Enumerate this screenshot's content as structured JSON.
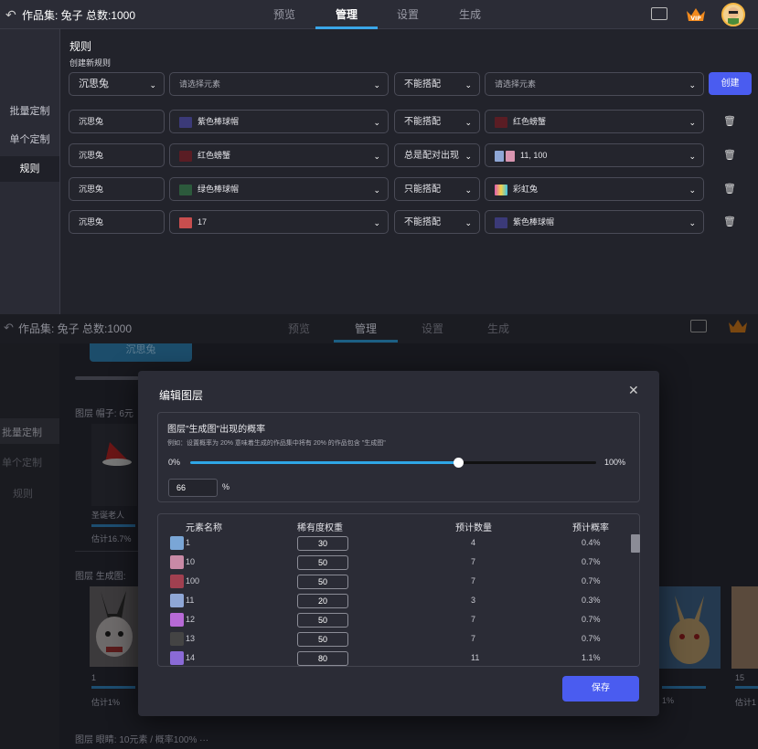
{
  "app": {
    "title": "作品集: 兔子  总数:1000",
    "tabs": [
      "预览",
      "管理",
      "设置",
      "生成"
    ],
    "active_tab": "管理"
  },
  "sidebar": {
    "items": [
      "批量定制",
      "单个定制",
      "规则"
    ],
    "active": "规则"
  },
  "rules": {
    "title": "规则",
    "create_label": "创建新规则",
    "new_rule": {
      "layer": "沉思兔",
      "element": "请选择元素",
      "relation": "不能搭配",
      "target": "请选择元素",
      "create_button": "创建"
    },
    "list": [
      {
        "layer": "沉思兔",
        "element": "紫色棒球帽",
        "relation": "不能搭配",
        "target": "红色螃蟹"
      },
      {
        "layer": "沉思兔",
        "element": "红色螃蟹",
        "relation": "总是配对出现",
        "target": "11, 100"
      },
      {
        "layer": "沉思兔",
        "element": "绿色棒球帽",
        "relation": "只能搭配",
        "target": "彩虹兔"
      },
      {
        "layer": "沉思兔",
        "element": "17",
        "relation": "不能搭配",
        "target": "紫色棒球帽"
      }
    ]
  },
  "background": {
    "title": "作品集: 兔子  总数:1000",
    "tabs": [
      "预览",
      "管理",
      "设置",
      "生成"
    ],
    "sidebar": [
      "批量定制",
      "单个定制",
      "规则"
    ],
    "chip": "沉思兔",
    "layer1": "图层  帽子: 6元",
    "layer1_item": "圣诞老人",
    "layer1_est": "估计16.7%",
    "layer2": "图层  生成图:",
    "card_left_label": "1",
    "card_left_est": "估计1%",
    "card_right_label1": "15",
    "card_right_est1": "估计1",
    "card_right_est2": "1%",
    "layer3": "图层  眼睛: 10元素 / 概率100%  ···"
  },
  "modal": {
    "title": "编辑图层",
    "prob_title": "图层\"生成图\"出现的概率",
    "prob_hint": "例如：设置概率为 20% 意味着生成的作品集中将有 20% 的作品包含 \"生成图\"",
    "min_label": "0%",
    "max_label": "100%",
    "value": "66",
    "value_percent": 66,
    "unit": "%",
    "columns": [
      "元素名称",
      "稀有度权重",
      "预计数量",
      "预计概率"
    ],
    "rows": [
      {
        "name": "1",
        "weight": "30",
        "count": "4",
        "prob": "0.4%"
      },
      {
        "name": "10",
        "weight": "50",
        "count": "7",
        "prob": "0.7%"
      },
      {
        "name": "100",
        "weight": "50",
        "count": "7",
        "prob": "0.7%"
      },
      {
        "name": "11",
        "weight": "20",
        "count": "3",
        "prob": "0.3%"
      },
      {
        "name": "12",
        "weight": "50",
        "count": "7",
        "prob": "0.7%"
      },
      {
        "name": "13",
        "weight": "50",
        "count": "7",
        "prob": "0.7%"
      },
      {
        "name": "14",
        "weight": "80",
        "count": "11",
        "prob": "1.1%"
      }
    ],
    "save": "保存"
  }
}
